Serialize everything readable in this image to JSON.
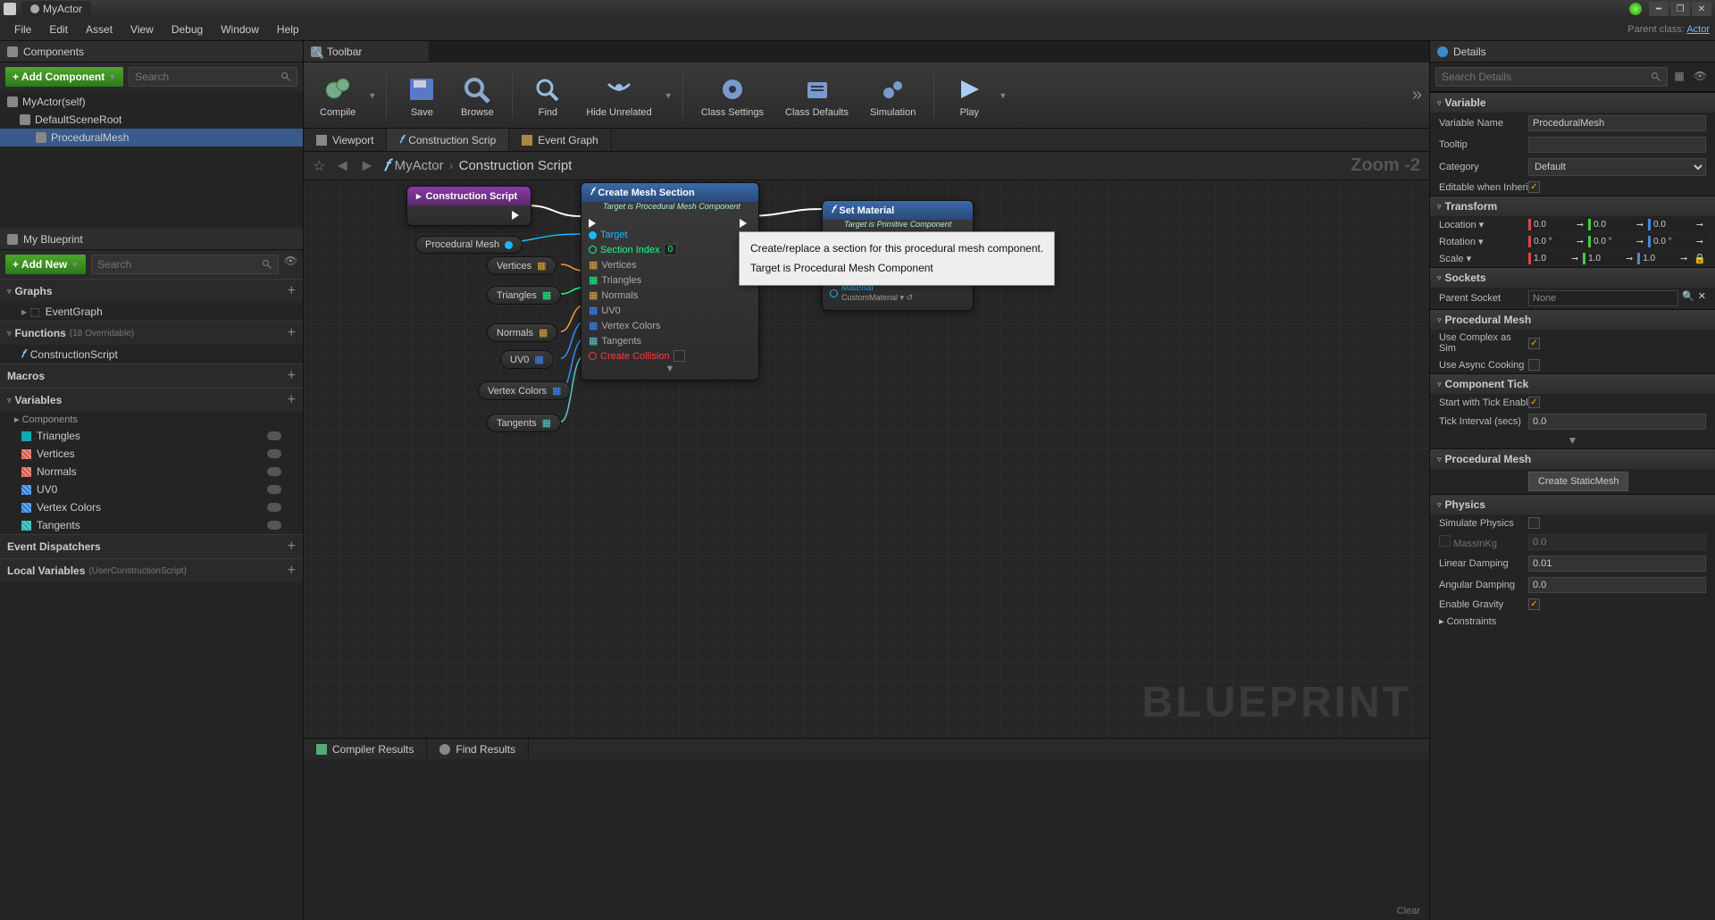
{
  "titlebar": {
    "title": "MyActor"
  },
  "window_controls": {
    "min": "━",
    "max": "❐",
    "close": "✕"
  },
  "menubar": {
    "items": [
      "File",
      "Edit",
      "Asset",
      "View",
      "Debug",
      "Window",
      "Help"
    ],
    "parent_label": "Parent class:",
    "parent_value": "Actor"
  },
  "components_panel": {
    "title": "Components",
    "add_btn": "+ Add Component",
    "search_ph": "Search",
    "tree": [
      {
        "label": "MyActor(self)",
        "indent": 0
      },
      {
        "label": "DefaultSceneRoot",
        "indent": 1
      },
      {
        "label": "ProceduralMesh",
        "indent": 2,
        "sel": true
      }
    ]
  },
  "my_blueprint": {
    "title": "My Blueprint",
    "add_btn": "+ Add New",
    "search_ph": "Search",
    "sections": [
      {
        "name": "Graphs",
        "items": [
          {
            "label": "EventGraph",
            "icon": ""
          }
        ]
      },
      {
        "name": "Functions",
        "suffix": "(18 Overridable)",
        "items": [
          {
            "label": "ConstructionScript",
            "icon": "f"
          }
        ]
      },
      {
        "name": "Macros",
        "items": []
      },
      {
        "name": "Variables",
        "subhead": "Components",
        "items": [
          {
            "label": "Triangles",
            "icon": "cyan"
          },
          {
            "label": "Vertices",
            "icon": "orange"
          },
          {
            "label": "Normals",
            "icon": "orange"
          },
          {
            "label": "UV0",
            "icon": "blue"
          },
          {
            "label": "Vertex Colors",
            "icon": "blue"
          },
          {
            "label": "Tangents",
            "icon": "teal"
          }
        ]
      },
      {
        "name": "Event Dispatchers",
        "items": []
      },
      {
        "name": "Local Variables",
        "suffix": "(UserConstructionScript)",
        "items": []
      }
    ]
  },
  "toolbar": {
    "title": "Toolbar",
    "buttons": [
      {
        "label": "Compile",
        "drop": true
      },
      {
        "label": "Save"
      },
      {
        "label": "Browse"
      },
      {
        "label": "Find"
      },
      {
        "label": "Hide Unrelated",
        "drop": true
      },
      {
        "label": "Class Settings"
      },
      {
        "label": "Class Defaults"
      },
      {
        "label": "Simulation"
      },
      {
        "label": "Play",
        "drop": true
      }
    ]
  },
  "graph_tabs": [
    {
      "label": "Viewport",
      "icon": "viewport"
    },
    {
      "label": "Construction Scrip",
      "icon": "func",
      "active": true
    },
    {
      "label": "Event Graph",
      "icon": "graph"
    }
  ],
  "breadcrumb": {
    "root": "MyActor",
    "leaf": "Construction Script",
    "zoom": "Zoom -2"
  },
  "graph": {
    "watermark": "BLUEPRINT",
    "construction_node": {
      "title": "Construction Script"
    },
    "create_mesh_node": {
      "title": "Create Mesh Section",
      "subtitle": "Target is Procedural Mesh Component",
      "pins": [
        "Target",
        "Section Index",
        "Vertices",
        "Triangles",
        "Normals",
        "UV0",
        "Vertex Colors",
        "Tangents",
        "Create Collision"
      ],
      "section_index_val": "0"
    },
    "set_material_node": {
      "title": "Set Material",
      "subtitle": "Target is Primitive Component",
      "material_label": "Material",
      "material_val": "CustomMaterial"
    },
    "procedural_mesh_pill": "Procedural Mesh",
    "var_pills": [
      "Vertices",
      "Triangles",
      "Normals",
      "UV0",
      "Vertex Colors",
      "Tangents"
    ],
    "tooltip": {
      "line1": "Create/replace a section for this procedural mesh component.",
      "line2": "Target is Procedural Mesh Component"
    }
  },
  "bottom_tabs": [
    "Compiler Results",
    "Find Results"
  ],
  "bottom_clear": "Clear",
  "details": {
    "title": "Details",
    "search_ph": "Search Details",
    "variable": {
      "header": "Variable",
      "name_lbl": "Variable Name",
      "name_val": "ProceduralMesh",
      "tooltip_lbl": "Tooltip",
      "tooltip_val": "",
      "category_lbl": "Category",
      "category_val": "Default",
      "editable_lbl": "Editable when Inheri"
    },
    "transform": {
      "header": "Transform",
      "location_lbl": "Location",
      "location": [
        "0.0",
        "0.0",
        "0.0"
      ],
      "rotation_lbl": "Rotation",
      "rotation": [
        "0.0 °",
        "0.0 °",
        "0.0 °"
      ],
      "scale_lbl": "Scale",
      "scale": [
        "1.0",
        "1.0",
        "1.0"
      ]
    },
    "sockets": {
      "header": "Sockets",
      "parent_lbl": "Parent Socket",
      "parent_val": "None"
    },
    "procmesh": {
      "header": "Procedural Mesh",
      "complex_lbl": "Use Complex as Sim",
      "async_lbl": "Use Async Cooking"
    },
    "tick": {
      "header": "Component Tick",
      "start_lbl": "Start with Tick Enabl",
      "interval_lbl": "Tick Interval (secs)",
      "interval_val": "0.0"
    },
    "procmesh2": {
      "header": "Procedural Mesh",
      "btn": "Create StaticMesh"
    },
    "physics": {
      "header": "Physics",
      "sim_lbl": "Simulate Physics",
      "mass_lbl": "MassInKg",
      "mass_val": "0.0",
      "linear_lbl": "Linear Damping",
      "linear_val": "0.01",
      "angular_lbl": "Angular Damping",
      "angular_val": "0.0",
      "gravity_lbl": "Enable Gravity",
      "constraints_lbl": "Constraints"
    }
  }
}
